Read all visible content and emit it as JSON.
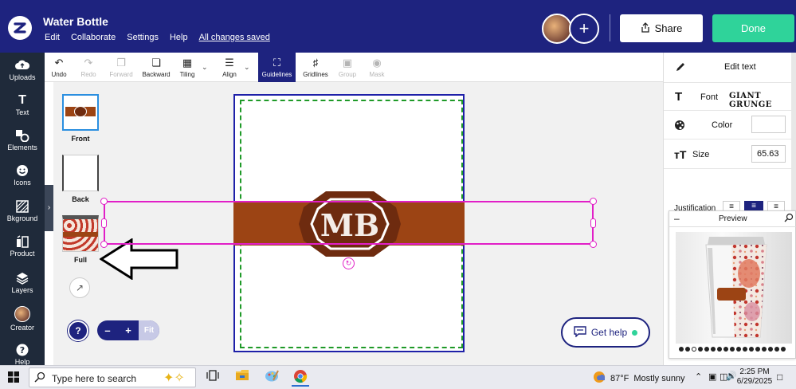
{
  "header": {
    "app_title": "Water Bottle",
    "menu": [
      "Edit",
      "Collaborate",
      "Settings",
      "Help"
    ],
    "saved_status": "All changes saved",
    "share_label": "Share",
    "done_label": "Done",
    "add_collaborator_symbol": "+"
  },
  "sidebar": {
    "items": [
      {
        "label": "Uploads",
        "icon": "cloud-upload-icon"
      },
      {
        "label": "Text",
        "icon": "text-icon"
      },
      {
        "label": "Elements",
        "icon": "elements-icon"
      },
      {
        "label": "Icons",
        "icon": "smiley-icon"
      },
      {
        "label": "Bkground",
        "icon": "background-icon"
      },
      {
        "label": "Product",
        "icon": "product-icon"
      },
      {
        "label": "Layers",
        "icon": "layers-icon"
      },
      {
        "label": "Creator",
        "icon": "creator-avatar-icon"
      },
      {
        "label": "Help",
        "icon": "help-icon"
      }
    ]
  },
  "toolbar": {
    "undo": "Undo",
    "redo": "Redo",
    "forward": "Forward",
    "backward": "Backward",
    "tiling": "Tiling",
    "align": "Align",
    "guidelines": "Guidelines",
    "gridlines": "Gridlines",
    "group": "Group",
    "mask": "Mask"
  },
  "views": [
    {
      "label": "Front"
    },
    {
      "label": "Back"
    },
    {
      "label": "Full"
    }
  ],
  "canvas": {
    "monogram_text": "MB",
    "band_color": "#9c4414",
    "oval_color": "#6e2b0f",
    "selection_color": "#e11fc7",
    "guide_color": "#1f9a28",
    "page_border_color": "#1e20a8"
  },
  "zoom": {
    "minus": "–",
    "plus": "+",
    "fit": "Fit"
  },
  "help_button": {
    "symbol": "?",
    "get_help": "Get help"
  },
  "right_panel": {
    "title": "Edit text",
    "font_label": "Font",
    "font_value": "GIANT GRUNGE",
    "color_label": "Color",
    "size_label": "Size",
    "size_value": "65.63",
    "justification_label": "Justification"
  },
  "preview": {
    "title": "Preview",
    "minimize": "–",
    "dot_count": 17,
    "selected_dot": 2
  },
  "taskbar": {
    "search_placeholder": "Type here to search",
    "weather_temp": "87°F",
    "weather_desc": "Mostly sunny",
    "time": "2:25 PM",
    "date": "6/29/2025"
  },
  "colors": {
    "brand": "#1e237f",
    "done": "#2fd39a",
    "sidebar": "#1f2a3a"
  }
}
